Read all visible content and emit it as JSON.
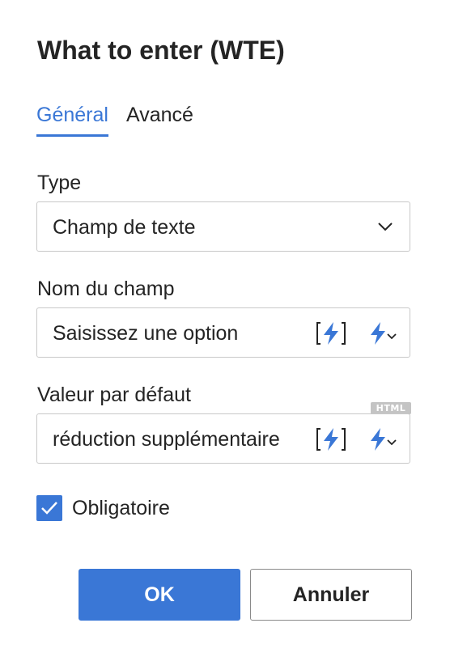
{
  "dialog": {
    "title": "What to enter (WTE)"
  },
  "tabs": [
    {
      "label": "Général",
      "active": true
    },
    {
      "label": "Avancé",
      "active": false
    }
  ],
  "type_field": {
    "label": "Type",
    "value": "Champ de texte"
  },
  "name_field": {
    "label": "Nom du champ",
    "value": "Saisissez une option"
  },
  "default_field": {
    "label": "Valeur par défaut",
    "value": "réduction supplémentaire",
    "badge": "HTML"
  },
  "required": {
    "label": "Obligatoire",
    "checked": true
  },
  "buttons": {
    "ok": "OK",
    "cancel": "Annuler"
  },
  "colors": {
    "accent": "#3a77d6",
    "border": "#c8c8c8",
    "badge": "#c4c4c4"
  },
  "icons": [
    "chevron-down-icon",
    "dynamic-content-bracket-icon",
    "lightning-icon",
    "checkmark-icon"
  ]
}
